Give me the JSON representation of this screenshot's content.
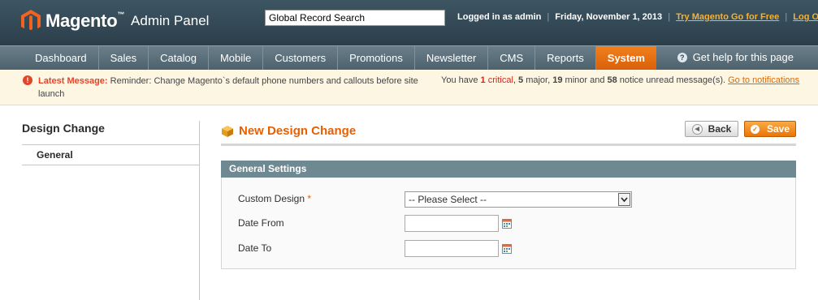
{
  "header": {
    "brand": "Magento",
    "brand_tm": "™",
    "subtitle": "Admin Panel",
    "search_value": "Global Record Search",
    "logged_in": "Logged in as admin",
    "date": "Friday, November 1, 2013",
    "try_link": "Try Magento Go for Free",
    "logout": "Log Out",
    "separator": "|"
  },
  "nav": {
    "items": [
      "Dashboard",
      "Sales",
      "Catalog",
      "Mobile",
      "Customers",
      "Promotions",
      "Newsletter",
      "CMS",
      "Reports",
      "System"
    ],
    "active": "System",
    "help": "Get help for this page"
  },
  "message": {
    "label": "Latest Message:",
    "text": "Reminder: Change Magento`s default phone numbers and callouts before site launch",
    "summary_prefix": "You have ",
    "critical_count": "1",
    "critical_label": "critical",
    "major_count": "5",
    "major_label": " major, ",
    "minor_count": "19",
    "minor_label": " minor and ",
    "notice_count": "58",
    "notice_label": " notice unread message(s).",
    "link": "Go to notifications"
  },
  "sidebar": {
    "title": "Design Change",
    "items": [
      {
        "label": "General"
      }
    ]
  },
  "content": {
    "page_title": "New Design Change",
    "back_label": "Back",
    "save_label": "Save",
    "fieldset_title": "General Settings",
    "fields": {
      "custom_design": {
        "label": "Custom Design",
        "required": "*",
        "value": "-- Please Select --"
      },
      "date_from": {
        "label": "Date From",
        "value": ""
      },
      "date_to": {
        "label": "Date To",
        "value": ""
      }
    }
  },
  "colors": {
    "accent": "#eb5e00",
    "nav_active": "#ea7508",
    "header_bg": "#34495a",
    "fieldset_head": "#6f8992"
  }
}
